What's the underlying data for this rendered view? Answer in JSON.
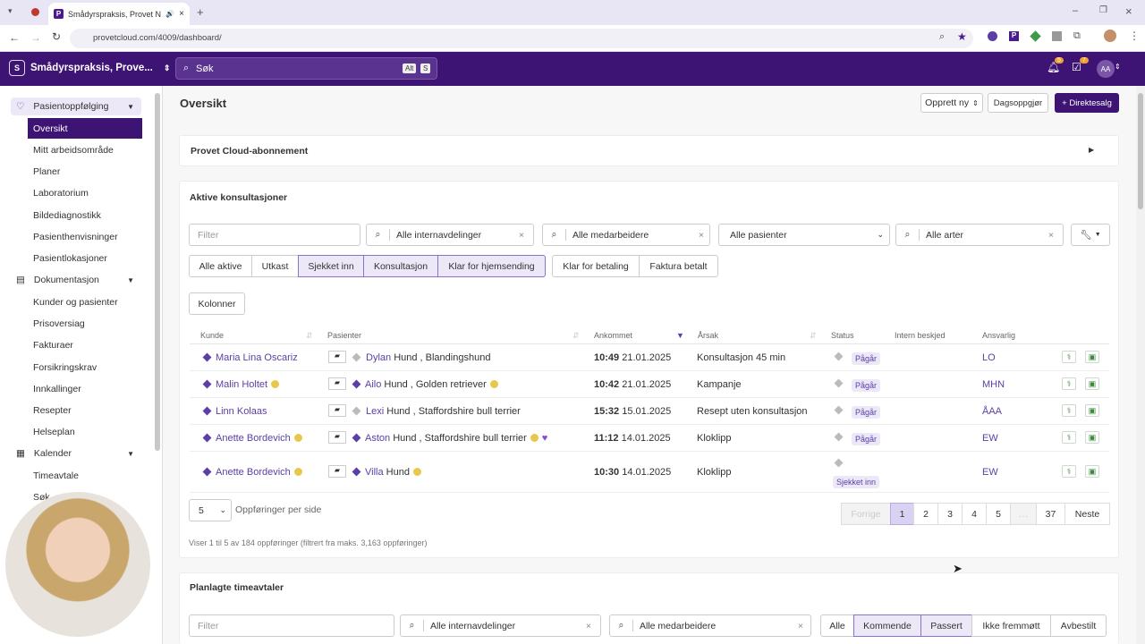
{
  "browser": {
    "tab_title": "Smådyrspraksis, Provet No",
    "url": "provetcloud.com/4009/dashboard/"
  },
  "app": {
    "org_initial": "S",
    "org_name": "Smådyrspraksis, Prove...",
    "search_placeholder": "Søk",
    "kbd_alt": "Alt",
    "kbd_s": "S",
    "notif_count": "5",
    "task_count": "7",
    "user_initials": "AA"
  },
  "sidebar": {
    "group1": "Pasientoppfølging",
    "items1": [
      "Oversikt",
      "Mitt arbeidsområde",
      "Planer",
      "Laboratorium",
      "Bildediagnostikk",
      "Pasienthenvisninger",
      "Pasientlokasjoner"
    ],
    "group2": "Dokumentasjon",
    "items2": [
      "Kunder og pasienter",
      "Prisoversiag",
      "Fakturaer",
      "Forsikringskrav",
      "Innkallinger",
      "Resepter",
      "Helseplan"
    ],
    "group3": "Kalender",
    "items3": [
      "Timeavtale",
      "Søk"
    ]
  },
  "header": {
    "title": "Oversikt",
    "create_new": "Opprett ny",
    "daily_tasks": "Dagsoppgjør",
    "direct_sale": "+ Direktesalg"
  },
  "subscription": {
    "title": "Provet Cloud-abonnement"
  },
  "consultations": {
    "title": "Aktive konsultasjoner",
    "filter_placeholder": "Filter",
    "departments": "Alle internavdelinger",
    "staff": "Alle medarbeidere",
    "patients": "Alle pasienter",
    "species": "Alle arter",
    "status_buttons": [
      "Alle aktive",
      "Utkast",
      "Sjekket inn",
      "Konsultasjon",
      "Klar for hjemsending"
    ],
    "status_buttons2": [
      "Klar for betaling",
      "Faktura betalt"
    ],
    "columns_button": "Kolonner",
    "headers": {
      "kunde": "Kunde",
      "pasienter": "Pasienter",
      "ankommet": "Ankommet",
      "arsak": "Årsak",
      "status": "Status",
      "intern": "Intern beskjed",
      "ansvarlig": "Ansvarlig"
    },
    "rows": [
      {
        "client": "Maria Lina Oscariz",
        "patient": "Dylan",
        "species": "Hund , Blandingshund",
        "time": "10:49",
        "date": "21.01.2025",
        "reason": "Konsultasjon 45 min",
        "status": "Pågår",
        "resp": "LO"
      },
      {
        "client": "Malin Holtet",
        "patient": "Ailo",
        "species": "Hund , Golden retriever",
        "time": "10:42",
        "date": "21.01.2025",
        "reason": "Kampanje",
        "status": "Pågår",
        "resp": "MHN"
      },
      {
        "client": "Linn Kolaas",
        "patient": "Lexi",
        "species": "Hund , Staffordshire bull terrier",
        "time": "15:32",
        "date": "15.01.2025",
        "reason": "Resept uten konsultasjon",
        "status": "Pågår",
        "resp": "ÅAA"
      },
      {
        "client": "Anette Bordevich",
        "patient": "Aston",
        "species": "Hund , Staffordshire bull terrier",
        "time": "11:12",
        "date": "14.01.2025",
        "reason": "Kloklipp",
        "status": "Pågår",
        "resp": "EW"
      },
      {
        "client": "Anette Bordevich",
        "patient": "Villa",
        "species": "Hund",
        "time": "10:30",
        "date": "14.01.2025",
        "reason": "Kloklipp",
        "status": "Sjekket inn",
        "resp": "EW"
      }
    ],
    "per_page_value": "5",
    "per_page_label": "Oppføringer per side",
    "pagination": {
      "prev": "Forrige",
      "pages": [
        "1",
        "2",
        "3",
        "4",
        "5"
      ],
      "ellipsis": "…",
      "last": "37",
      "next": "Neste"
    },
    "summary": "Viser 1 til 5 av 184 oppføringer (filtrert fra maks. 3,163 oppføringer)"
  },
  "appointments": {
    "title": "Planlagte timeavtaler",
    "filter_placeholder": "Filter",
    "departments": "Alle internavdelinger",
    "staff": "Alle medarbeidere",
    "buttons": [
      "Alle",
      "Kommende",
      "Passert",
      "Ikke fremmøtt",
      "Avbestilt"
    ]
  },
  "colors": {
    "brand": "#3d1373",
    "accent": "#5b3ea6"
  }
}
